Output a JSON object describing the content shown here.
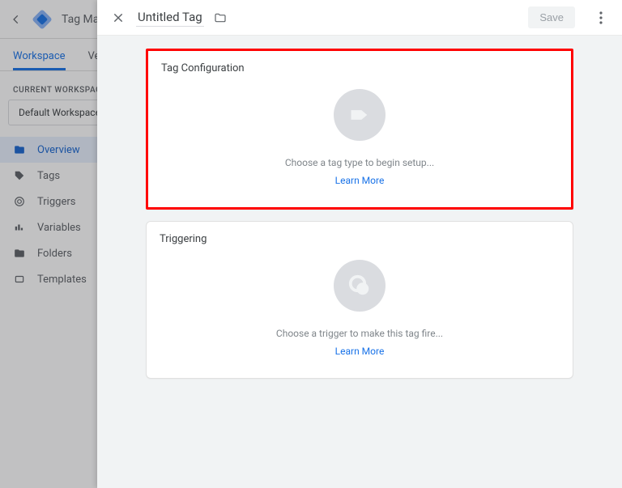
{
  "bg": {
    "title": "Tag Man",
    "tabs": {
      "workspace": "Workspace",
      "versions": "Version"
    },
    "current_workspace_label": "CURRENT WORKSPACE",
    "current_workspace_value": "Default Workspace",
    "nav": {
      "overview": "Overview",
      "tags": "Tags",
      "triggers": "Triggers",
      "variables": "Variables",
      "folders": "Folders",
      "templates": "Templates"
    }
  },
  "panel": {
    "title": "Untitled Tag",
    "save_label": "Save",
    "tag_config": {
      "heading": "Tag Configuration",
      "helper": "Choose a tag type to begin setup...",
      "learn_more": "Learn More"
    },
    "triggering": {
      "heading": "Triggering",
      "helper": "Choose a trigger to make this tag fire...",
      "learn_more": "Learn More"
    }
  }
}
